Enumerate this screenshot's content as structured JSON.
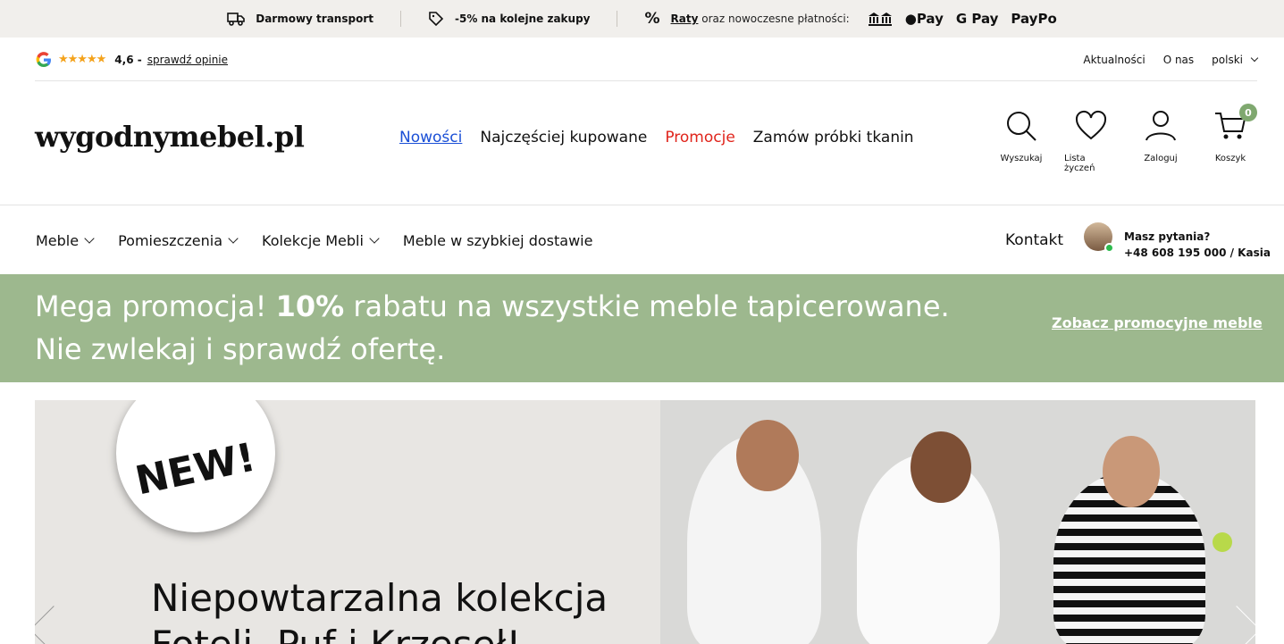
{
  "topbar": {
    "transport": "Darmowy transport",
    "discount": "-5% na kolejne zakupy",
    "raty": "Raty",
    "payments_text": "oraz nowoczesne płatności:",
    "apple_pay": "Pay",
    "google_pay": "G Pay",
    "paypo": "PayPo"
  },
  "util": {
    "rating_value": "4,6 -",
    "rating_link": "sprawdź opinie",
    "stars": "★★★★★",
    "links": [
      "Aktualności",
      "O nas"
    ],
    "language": "polski"
  },
  "header": {
    "logo": "wygodnymebel.pl",
    "nav": [
      "Nowości",
      "Najczęściej kupowane",
      "Promocje",
      "Zamów próbki tkanin"
    ],
    "icons": {
      "search": "Wyszukaj",
      "wishlist": "Lista życzeń",
      "login": "Zaloguj",
      "cart": "Koszyk",
      "cart_count": "0"
    }
  },
  "catnav": {
    "items": [
      "Meble",
      "Pomieszczenia",
      "Kolekcje Mebli",
      "Meble w szybkiej dostawie"
    ],
    "contact": "Kontakt",
    "question": "Masz pytania?",
    "phone": "+48 608 195 000 / Kasia"
  },
  "promo": {
    "text_before": "Mega promocja!",
    "text_bold": "10%",
    "text_after": "rabatu na wszystkie meble tapicerowane. Nie zwlekaj i sprawdź ofertę.",
    "link": "Zobacz promocyjne meble"
  },
  "hero": {
    "badge": "NEW!",
    "title_line1": "Niepowtarzalna kolekcja",
    "title_line2": "Foteli, Puf i Krzeseł!"
  },
  "colors": {
    "promo_green": "#9db88e",
    "accent_red": "#e0251c",
    "link_blue": "#1a4fd6",
    "badge_green": "#7fa86f"
  }
}
